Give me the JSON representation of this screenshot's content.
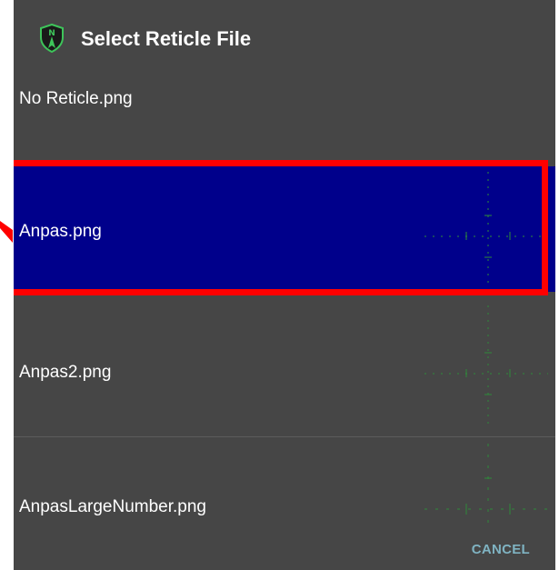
{
  "dialog": {
    "title": "Select Reticle File",
    "icon": "shield-compass-icon"
  },
  "items": [
    {
      "label": "No Reticle.png",
      "selected": false
    },
    {
      "label": "Anpas.png",
      "selected": true
    },
    {
      "label": "Anpas2.png",
      "selected": false
    },
    {
      "label": "AnpasLargeNumber.png",
      "selected": false
    }
  ],
  "actions": {
    "cancel_label": "CANCEL"
  },
  "colors": {
    "dialog_bg": "#464646",
    "selected_bg": "#00008b",
    "highlight_border": "#ff0000",
    "reticle_green": "#2e8b3a",
    "cancel_text": "#7fb3c2"
  }
}
